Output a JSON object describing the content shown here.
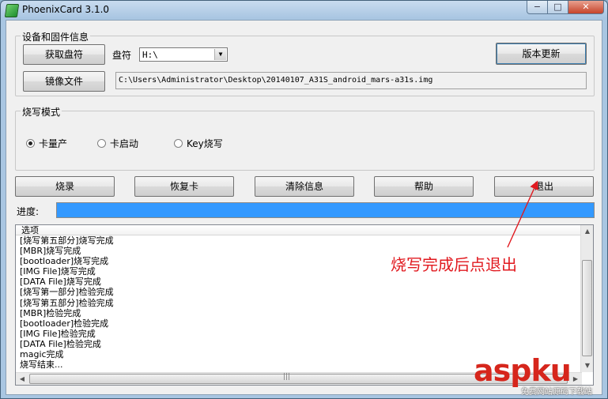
{
  "window": {
    "title": "PhoenixCard 3.1.0",
    "min": "−",
    "max": "□",
    "close": "✕"
  },
  "device_group": {
    "label": "设备和固件信息",
    "get_drive_button": "获取盘符",
    "drive_label": "盘符",
    "drive_value": "H:\\",
    "version_update_button": "版本更新",
    "image_file_button": "镜像文件",
    "image_path": "C:\\Users\\Administrator\\Desktop\\20140107_A31S_android_mars-a31s.img"
  },
  "burn_mode": {
    "label": "烧写模式",
    "options": [
      {
        "label": "卡量产",
        "selected": true
      },
      {
        "label": "卡启动",
        "selected": false
      },
      {
        "label": "Key烧写",
        "selected": false
      }
    ]
  },
  "actions": {
    "burn": "烧录",
    "restore": "恢复卡",
    "clear": "清除信息",
    "help": "帮助",
    "exit": "退出"
  },
  "progress": {
    "label": "进度:",
    "value": 100
  },
  "log": {
    "header": "选项",
    "lines": [
      "[烧写第五部分]烧写完成",
      "[MBR]烧写完成",
      "[bootloader]烧写完成",
      "[IMG File]烧写完成",
      "[DATA File]烧写完成",
      "[烧写第一部分]检验完成",
      "[烧写第五部分]检验完成",
      "[MBR]检验完成",
      "[bootloader]检验完成",
      "[IMG File]检验完成",
      "[DATA File]检验完成",
      "magic完成",
      "烧写结束..."
    ]
  },
  "annotation": {
    "text": "烧写完成后点退出",
    "color": "#e1191f"
  },
  "watermark": {
    "brand": "aspku",
    "subtitle": "免费网站源码下载站"
  }
}
